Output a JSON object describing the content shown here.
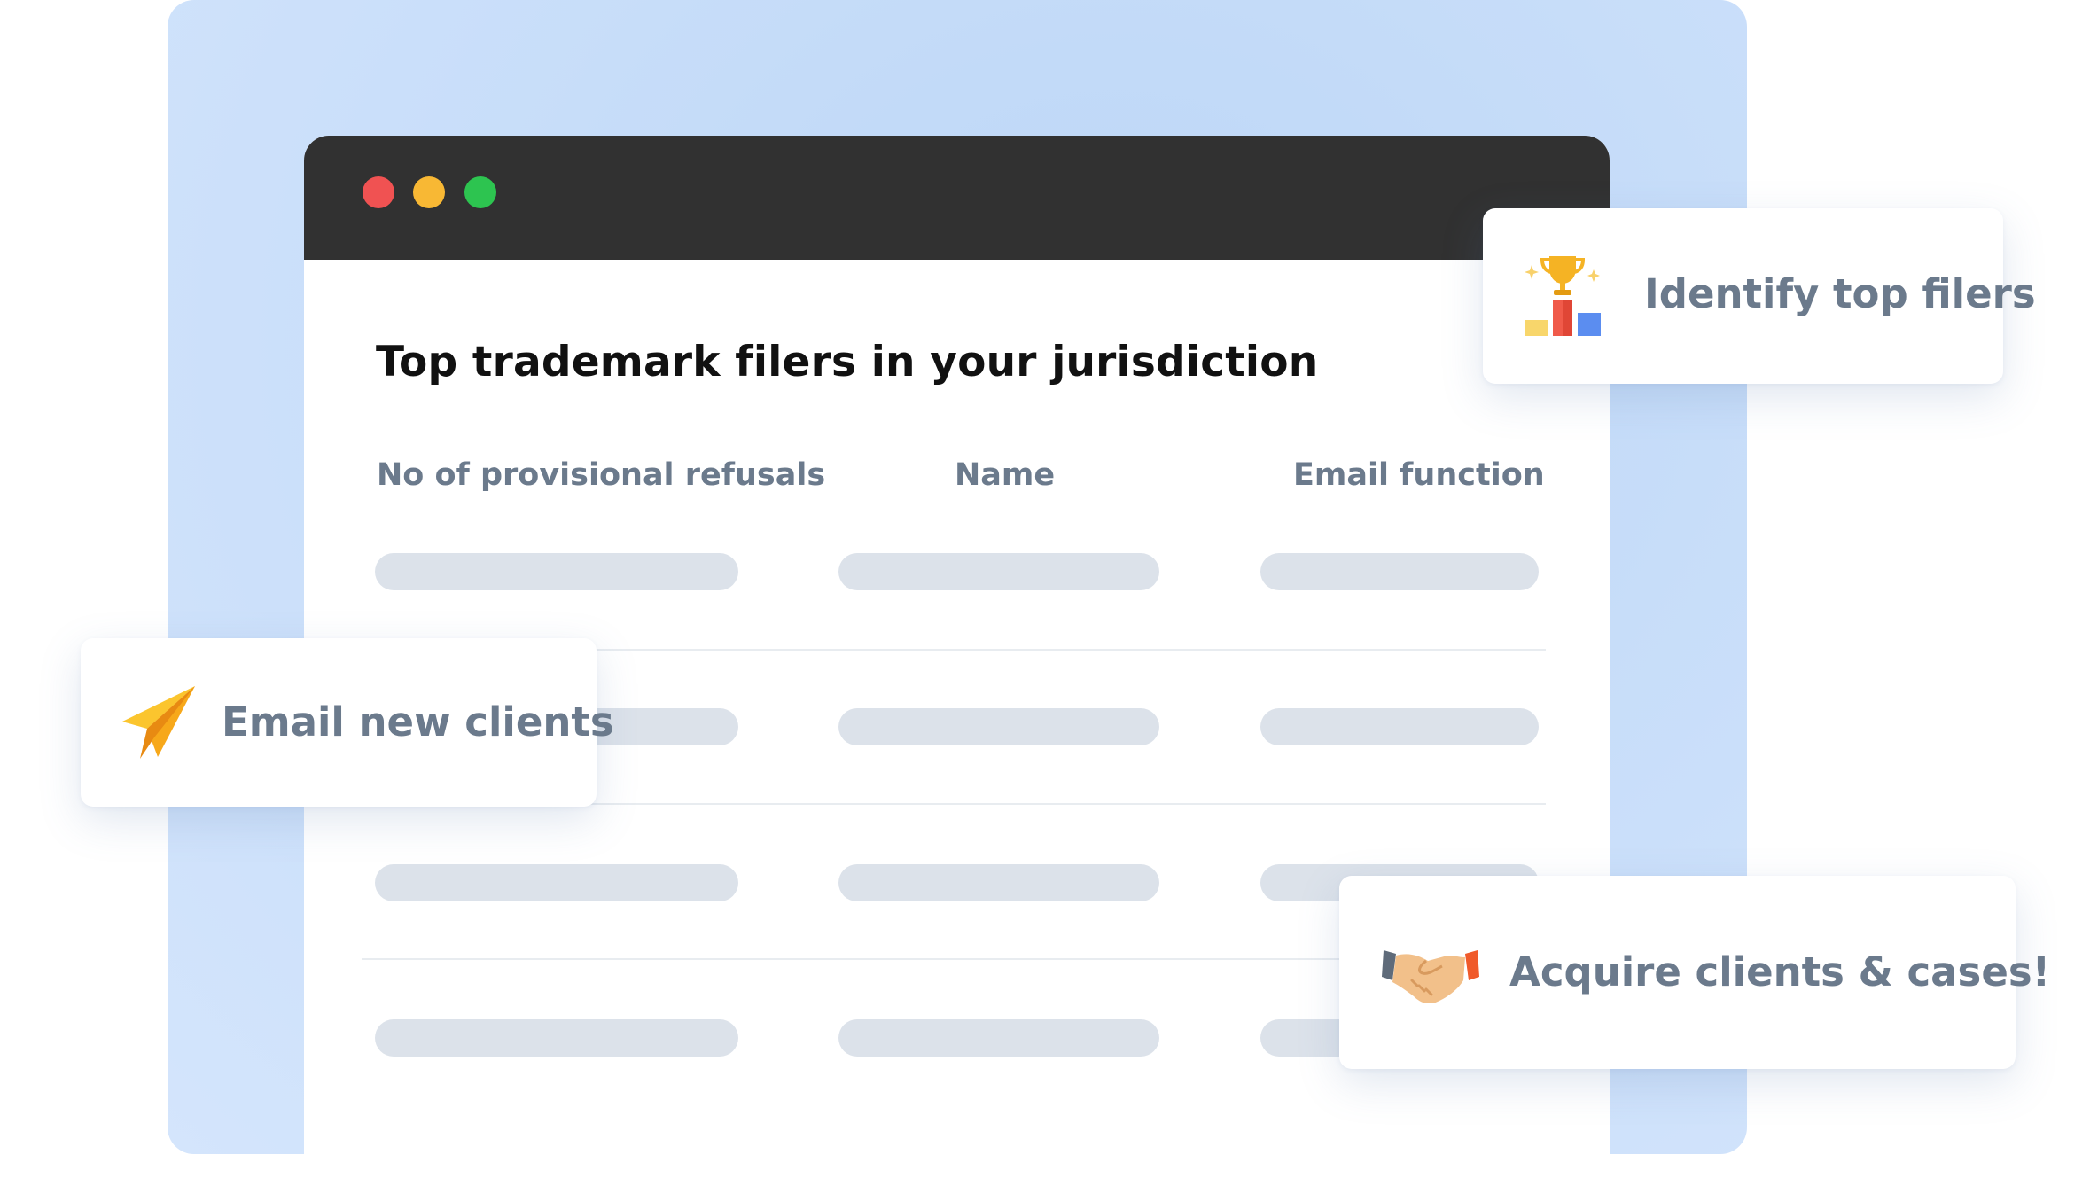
{
  "window": {
    "heading": "Top trademark filers in your jurisdiction",
    "columns": [
      "No of provisional refusals",
      "Name",
      "Email function"
    ],
    "row_count": 4
  },
  "cards": {
    "top": {
      "label": "Identify top filers",
      "icon": "trophy-podium-icon"
    },
    "left": {
      "label": "Email new clients",
      "icon": "paper-plane-icon"
    },
    "bottom": {
      "label": "Acquire clients & cases!",
      "icon": "handshake-icon"
    }
  },
  "colors": {
    "titlebar": "#313131",
    "dot_red": "#f05252",
    "dot_yellow": "#f8b834",
    "dot_green": "#2dc450",
    "placeholder_bar": "#dce2ea",
    "label_text": "#6b7a8c",
    "background_panel": "#c7ddf9"
  }
}
